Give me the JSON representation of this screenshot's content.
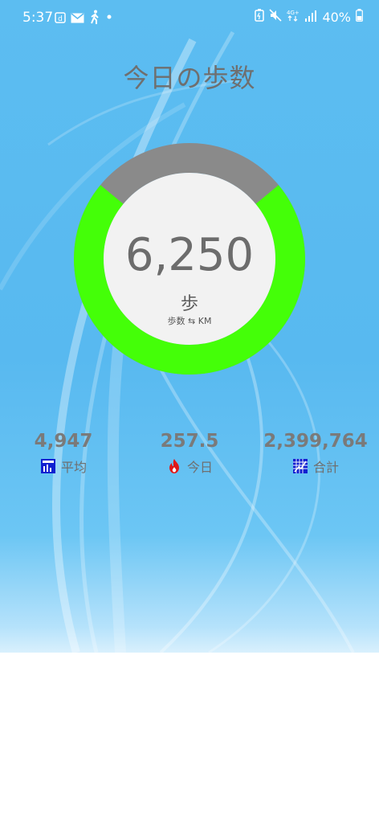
{
  "status_bar": {
    "time": "5:37",
    "battery": "40%",
    "network": "4G+",
    "icons_left": [
      "d-app-icon",
      "mail-icon",
      "walking-icon",
      "dot-icon"
    ],
    "icons_right": [
      "battery-saver-icon",
      "mute-icon",
      "network-icon",
      "signal-icon",
      "battery-icon"
    ]
  },
  "header": {
    "title": "今日の歩数"
  },
  "gauge": {
    "value": "6,250",
    "unit": "歩",
    "toggle_label": "歩数 ⇆ KM",
    "progress_fraction": 0.72,
    "colors": {
      "progress": "#44ff08",
      "remaining": "#8a8a8a",
      "center": "#f2f2f2"
    }
  },
  "stats": [
    {
      "value": "4,947",
      "label": "平均",
      "icon": "average-chart-icon",
      "icon_color": "#1020d0"
    },
    {
      "value": "257.5",
      "label": "今日",
      "icon": "fire-icon",
      "icon_color": "#e01818"
    },
    {
      "value": "2,399,764",
      "label": "合計",
      "icon": "total-grid-icon",
      "icon_color": "#1020d0"
    }
  ]
}
